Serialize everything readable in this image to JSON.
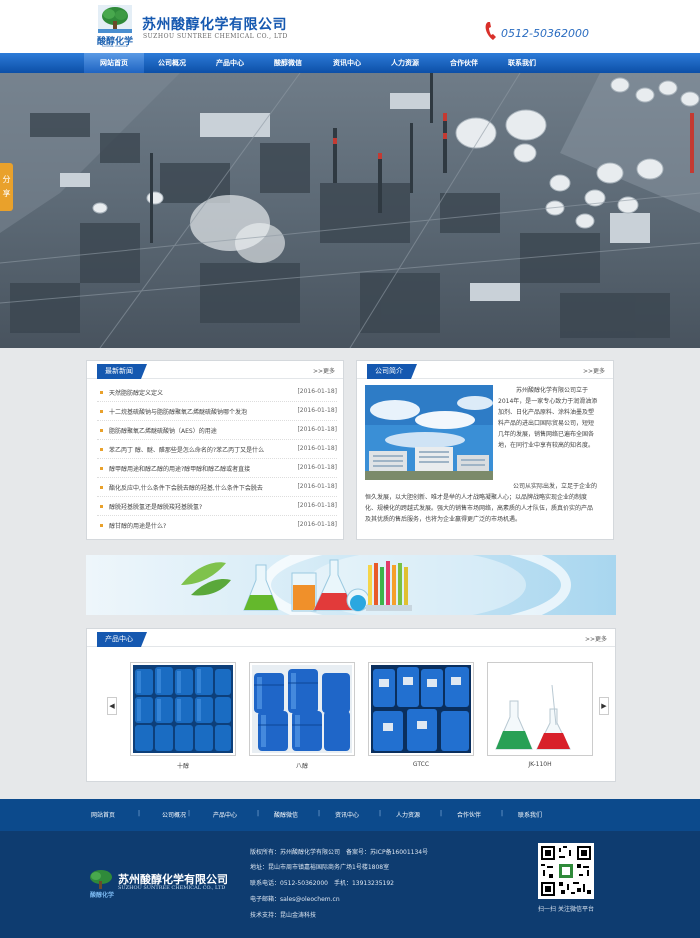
{
  "header": {
    "logo_cn": "酸醇化学",
    "logo_en": "Suntree chemical",
    "company_name": "苏州酸醇化学有限公司",
    "company_en": "SUZHOU SUNTREE CHEMICAL CO., LTD",
    "phone": "0512-50362000"
  },
  "nav": [
    {
      "label": "网站首页"
    },
    {
      "label": "公司概况"
    },
    {
      "label": "产品中心"
    },
    {
      "label": "酸醇微信"
    },
    {
      "label": "资讯中心"
    },
    {
      "label": "人力资源"
    },
    {
      "label": "合作伙伴"
    },
    {
      "label": "联系我们"
    }
  ],
  "share": "分享",
  "news": {
    "title": "最新新闻",
    "more": ">>更多",
    "items": [
      {
        "title": "天然脂肪醇定义定义",
        "date": "[2016-01-18]"
      },
      {
        "title": "十二烷基硫酸钠与脂肪醇聚氧乙烯醚硫酸钠哪个发泡",
        "date": "[2016-01-18]"
      },
      {
        "title": "脂肪醇聚氧乙烯醚硫酸钠（AES）的用途",
        "date": "[2016-01-18]"
      },
      {
        "title": "苯乙丙丁 醇、醚、醛那些是怎么命名的?苯乙丙丁又是什么",
        "date": "[2016-01-18]"
      },
      {
        "title": "醇甲醇用途和醇乙醇的用途?醇甲醇和醇乙醇或者直接",
        "date": "[2016-01-18]"
      },
      {
        "title": "酯化反应中,什么条件下会脱去醇的羟基,什么条件下会脱去",
        "date": "[2016-01-18]"
      },
      {
        "title": "醇脱羟基脱氢还是醇脱羧羟基脱氢?",
        "date": "[2016-01-18]"
      },
      {
        "title": "醇甘醇的用途是什么?",
        "date": "[2016-01-18]"
      }
    ]
  },
  "about": {
    "title": "公司简介",
    "more": ">>更多",
    "intro": "苏州酸醇化学有限公司立于2014年，是一家专心致力于润滑油添加剂、日化产品原料、涂料油墨及塑料产品的进出口国际贸易公司，短短几年的发展，销售网络已遍布全国各地，在同行业中享有较高的知名度。",
    "body": "公司从实际出发，立足于企业的恒久发展，以大胆创新、唯才是举的人才战略凝聚人心；以品牌战略实现企业的制度化、规模化的跨越式发展。强大的销售市场网络，高素质的人才队伍，质真价实的产品及其优质的售后服务，也将为企业赢得更广泛的市场机遇。"
  },
  "products": {
    "title": "产品中心",
    "more": ">>更多",
    "items": [
      {
        "name": "十醇"
      },
      {
        "name": "八醇"
      },
      {
        "name": "GTCC"
      },
      {
        "name": "JK-110H"
      }
    ]
  },
  "footer_nav": [
    {
      "label": "网站首页"
    },
    {
      "label": "公司概况"
    },
    {
      "label": "产品中心"
    },
    {
      "label": "酸醇微信"
    },
    {
      "label": "资讯中心"
    },
    {
      "label": "人力资源"
    },
    {
      "label": "合作伙伴"
    },
    {
      "label": "联系我们"
    }
  ],
  "footer": {
    "logo_name": "苏州酸醇化学有限公司",
    "logo_en": "SUZHOU SUNTREE CHEMICAL CO., LTD",
    "logo_cn": "酸醇化学",
    "copyright": "版权所有：苏州酸醇化学有限公司　备案号：苏ICP备16001134号",
    "address": "地址：昆山市周市镇嘉裕国际商务广场1号楼1808室",
    "phone": "联系电话：0512-50362000　手机：13913235192",
    "email": "电子邮箱：sales@oleochem.cn",
    "support": "技术支持：昆山金涛科技",
    "qr_caption": "扫一扫 关注微信平台"
  },
  "colors": {
    "primary": "#1558b0",
    "accent": "#e9a12b",
    "footer": "#0e3c70"
  }
}
